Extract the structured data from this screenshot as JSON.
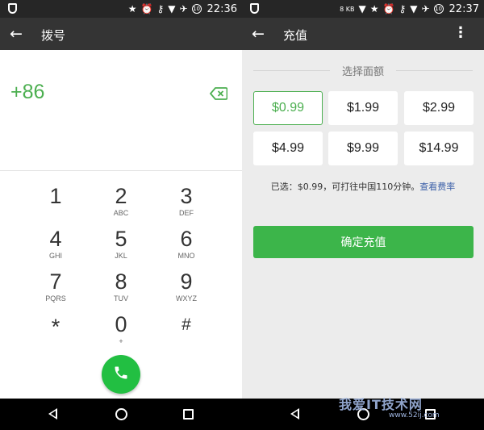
{
  "left": {
    "status": {
      "time": "22:36",
      "badge": "10"
    },
    "appbar": {
      "title": "拨号"
    },
    "dialer": {
      "number": "+86",
      "keys": [
        {
          "digit": "1",
          "letters": ""
        },
        {
          "digit": "2",
          "letters": "ABC"
        },
        {
          "digit": "3",
          "letters": "DEF"
        },
        {
          "digit": "4",
          "letters": "GHI"
        },
        {
          "digit": "5",
          "letters": "JKL"
        },
        {
          "digit": "6",
          "letters": "MNO"
        },
        {
          "digit": "7",
          "letters": "PQRS"
        },
        {
          "digit": "8",
          "letters": "TUV"
        },
        {
          "digit": "9",
          "letters": "WXYZ"
        },
        {
          "digit": "*",
          "letters": ""
        },
        {
          "digit": "0",
          "letters": "+"
        },
        {
          "digit": "#",
          "letters": ""
        }
      ]
    }
  },
  "right": {
    "status": {
      "time": "22:37",
      "badge": "10",
      "speed": "8 KB"
    },
    "appbar": {
      "title": "充值"
    },
    "section_label": "选择面额",
    "amounts": [
      "$0.99",
      "$1.99",
      "$2.99",
      "$4.99",
      "$9.99",
      "$14.99"
    ],
    "selected_index": 0,
    "selected_info": "已选：$0.99，可打往中国110分钟。",
    "rate_link": "查看费率",
    "confirm_label": "确定充值",
    "watermark": "我爱IT技术网",
    "watermark_sub": "www.52ij.com"
  },
  "colors": {
    "accent_green": "#4caf50",
    "call_green": "#22bf42",
    "confirm_green": "#3cb54a",
    "appbar": "#343434",
    "statusbar": "#262626"
  },
  "icons": {
    "back": "arrow-left-icon",
    "backspace": "backspace-icon",
    "call": "phone-icon",
    "more": "more-vertical-icon"
  }
}
